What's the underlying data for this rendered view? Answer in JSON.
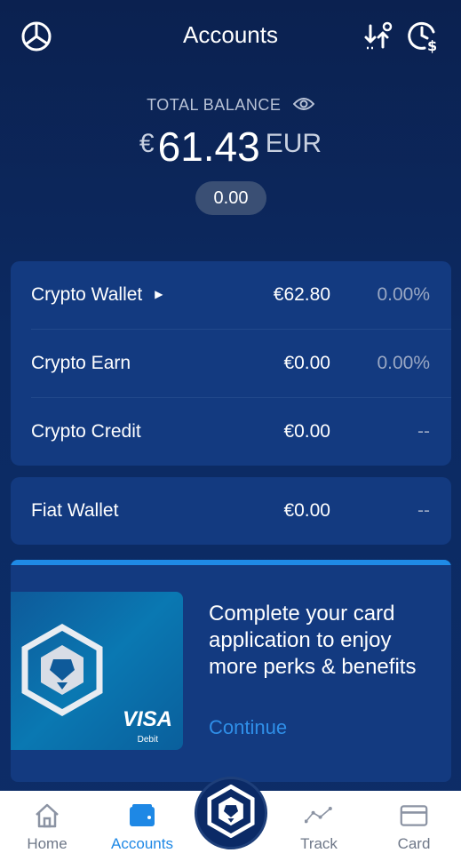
{
  "header": {
    "title": "Accounts",
    "left_icon": "pie-chart-icon",
    "right_icons": [
      "transfer-icon",
      "history-dollar-icon"
    ]
  },
  "balance": {
    "label": "TOTAL BALANCE",
    "currency_symbol": "€",
    "amount": "61.43",
    "currency_code": "EUR",
    "change": "0.00"
  },
  "accounts": [
    {
      "name": "Crypto Wallet",
      "value": "€62.80",
      "change": "0.00%",
      "has_arrow": true
    },
    {
      "name": "Crypto Earn",
      "value": "€0.00",
      "change": "0.00%"
    },
    {
      "name": "Crypto Credit",
      "value": "€0.00",
      "change": "--"
    }
  ],
  "fiat": {
    "name": "Fiat Wallet",
    "value": "€0.00",
    "change": "--"
  },
  "promo": {
    "text": "Complete your card application to enjoy more perks & benefits",
    "cta": "Continue",
    "card_brand": "VISA",
    "card_type": "Debit"
  },
  "tabs": [
    {
      "label": "Home",
      "icon": "home-icon"
    },
    {
      "label": "Accounts",
      "icon": "wallet-icon",
      "active": true
    },
    {
      "label": "Track",
      "icon": "chart-line-icon"
    },
    {
      "label": "Card",
      "icon": "card-icon"
    }
  ],
  "colors": {
    "background": "#0c2a62",
    "panel": "#133a80",
    "accent": "#1e88e5",
    "tabbar": "#ffffff"
  }
}
